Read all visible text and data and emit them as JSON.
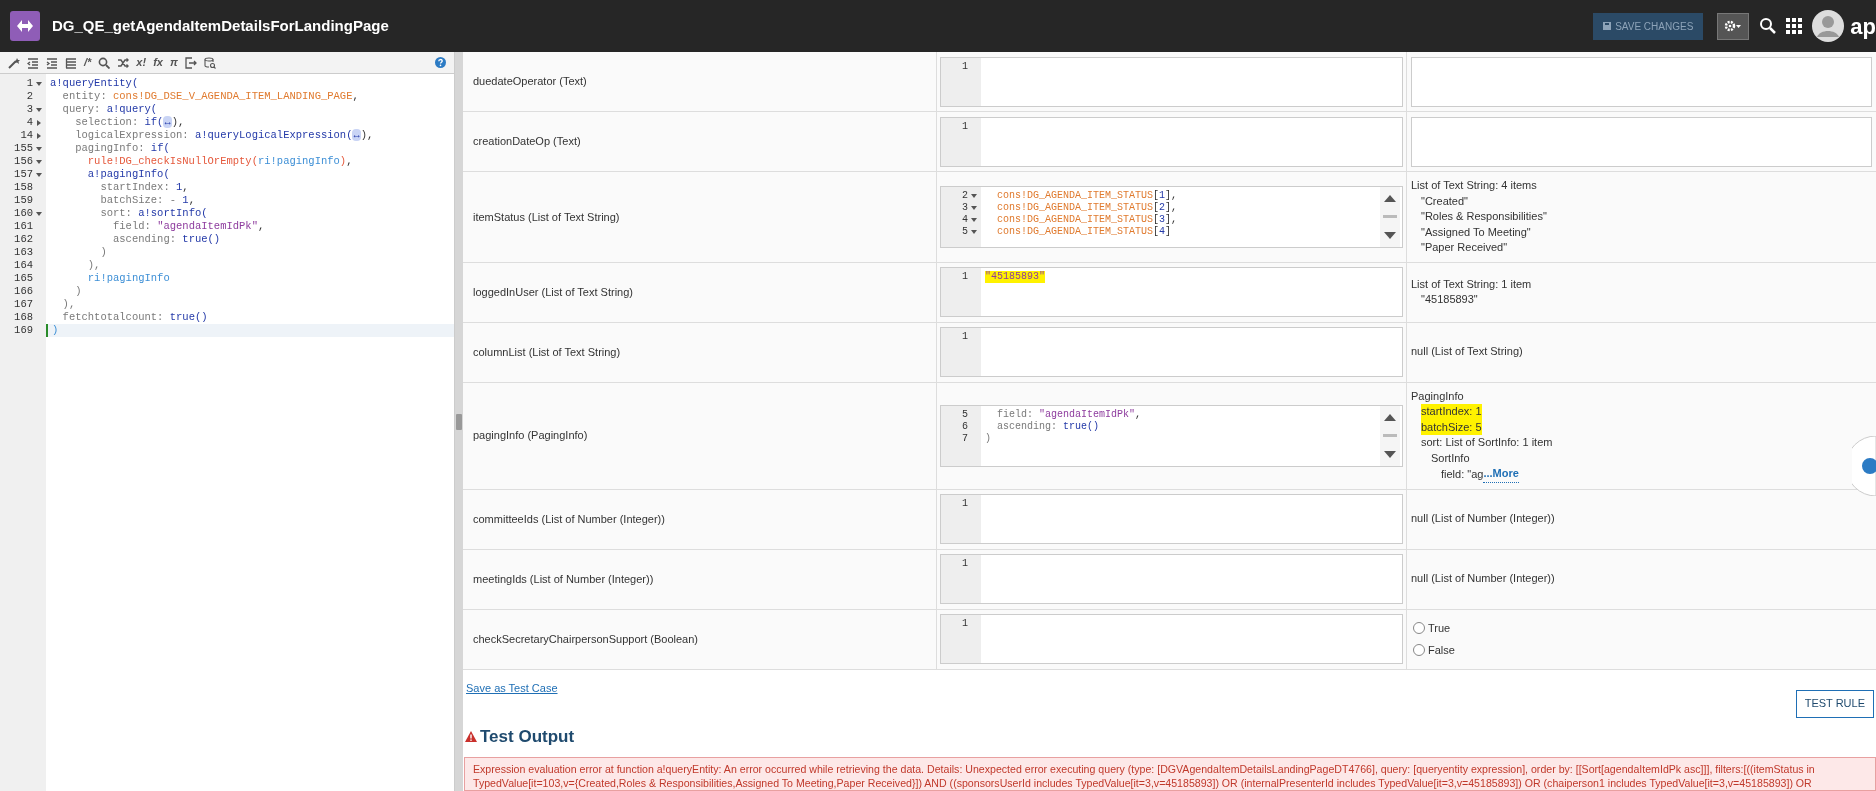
{
  "header": {
    "title": "DG_QE_getAgendaItemDetailsForLandingPage",
    "save_button": {
      "label": "SAVE CHANGES",
      "disabled": true
    },
    "brand_text": "ap"
  },
  "editor": {
    "toolbar": [
      {
        "kind": "wand"
      },
      {
        "kind": "outdent"
      },
      {
        "kind": "indent"
      },
      {
        "kind": "format"
      },
      {
        "kind": "glyph",
        "text": "/*"
      },
      {
        "kind": "search"
      },
      {
        "kind": "shuffle"
      },
      {
        "kind": "glyph",
        "text": "x!"
      },
      {
        "kind": "glyph",
        "text": "fx"
      },
      {
        "kind": "glyph",
        "text": "π"
      },
      {
        "kind": "export"
      },
      {
        "kind": "dbsearch"
      }
    ],
    "lines": [
      {
        "number": "1",
        "foldable": true,
        "expanded": true,
        "current": false,
        "tokens": [
          {
            "kind": "fn",
            "text": "a!queryEntity("
          }
        ]
      },
      {
        "number": "2",
        "foldable": false,
        "current": false,
        "tokens": [
          {
            "kind": "key",
            "text": "  entity: "
          },
          {
            "kind": "cons",
            "text": "cons!DG_DSE_V_AGENDA_ITEM_LANDING_PAGE"
          },
          {
            "kind": "punct",
            "text": ","
          }
        ]
      },
      {
        "number": "3",
        "foldable": true,
        "expanded": true,
        "current": false,
        "tokens": [
          {
            "kind": "key",
            "text": "  query: "
          },
          {
            "kind": "fn",
            "text": "a!query("
          }
        ]
      },
      {
        "number": "4",
        "foldable": true,
        "expanded": false,
        "current": false,
        "tokens": [
          {
            "kind": "key",
            "text": "    selection: "
          },
          {
            "kind": "fn",
            "text": "if("
          },
          {
            "kind": "folded",
            "text": "↔"
          },
          {
            "kind": "punct",
            "text": "),"
          }
        ]
      },
      {
        "number": "14",
        "foldable": true,
        "expanded": false,
        "current": false,
        "tokens": [
          {
            "kind": "key",
            "text": "    logicalExpression: "
          },
          {
            "kind": "fn",
            "text": "a!queryLogicalExpression("
          },
          {
            "kind": "folded",
            "text": "↔"
          },
          {
            "kind": "punct",
            "text": "),"
          }
        ]
      },
      {
        "number": "155",
        "foldable": true,
        "expanded": true,
        "current": false,
        "tokens": [
          {
            "kind": "key",
            "text": "    pagingInfo: "
          },
          {
            "kind": "fn",
            "text": "if("
          }
        ]
      },
      {
        "number": "156",
        "foldable": true,
        "expanded": true,
        "current": false,
        "tokens": [
          {
            "kind": "rule",
            "text": "      rule!DG_checkIsNullOrEmpty("
          },
          {
            "kind": "ri",
            "text": "ri!pagingInfo"
          },
          {
            "kind": "rule",
            "text": ")"
          },
          {
            "kind": "punct",
            "text": ","
          }
        ]
      },
      {
        "number": "157",
        "foldable": true,
        "expanded": true,
        "current": false,
        "tokens": [
          {
            "kind": "fn",
            "text": "      a!pagingInfo("
          }
        ]
      },
      {
        "number": "158",
        "foldable": false,
        "current": false,
        "tokens": [
          {
            "kind": "key",
            "text": "        startIndex: "
          },
          {
            "kind": "num",
            "text": "1"
          },
          {
            "kind": "punct",
            "text": ","
          }
        ]
      },
      {
        "number": "159",
        "foldable": false,
        "current": false,
        "tokens": [
          {
            "kind": "key",
            "text": "        batchSize: - "
          },
          {
            "kind": "num",
            "text": "1"
          },
          {
            "kind": "punct",
            "text": ","
          }
        ]
      },
      {
        "number": "160",
        "foldable": true,
        "expanded": true,
        "current": false,
        "tokens": [
          {
            "kind": "key",
            "text": "        sort: "
          },
          {
            "kind": "fn",
            "text": "a!sortInfo("
          }
        ]
      },
      {
        "number": "161",
        "foldable": false,
        "current": false,
        "tokens": [
          {
            "kind": "key",
            "text": "          field: "
          },
          {
            "kind": "str",
            "text": "\"agendaItemIdPk\""
          },
          {
            "kind": "punct",
            "text": ","
          }
        ]
      },
      {
        "number": "162",
        "foldable": false,
        "current": false,
        "tokens": [
          {
            "kind": "key",
            "text": "          ascending: "
          },
          {
            "kind": "fn",
            "text": "true()"
          }
        ]
      },
      {
        "number": "163",
        "foldable": false,
        "current": false,
        "tokens": [
          {
            "kind": "key",
            "text": "        )"
          }
        ]
      },
      {
        "number": "164",
        "foldable": false,
        "current": false,
        "tokens": [
          {
            "kind": "key",
            "text": "      ),"
          }
        ]
      },
      {
        "number": "165",
        "foldable": false,
        "current": false,
        "tokens": [
          {
            "kind": "ri",
            "text": "      ri!pagingInfo"
          }
        ]
      },
      {
        "number": "166",
        "foldable": false,
        "current": false,
        "tokens": [
          {
            "kind": "key",
            "text": "    )"
          }
        ]
      },
      {
        "number": "167",
        "foldable": false,
        "current": false,
        "tokens": [
          {
            "kind": "key",
            "text": "  ),"
          }
        ]
      },
      {
        "number": "168",
        "foldable": false,
        "current": false,
        "tokens": [
          {
            "kind": "key",
            "text": "  fetchtotalcount: "
          },
          {
            "kind": "fn",
            "text": "true()"
          }
        ]
      },
      {
        "number": "169",
        "foldable": false,
        "current": true,
        "tokens": [
          {
            "kind": "ri",
            "text": ")"
          }
        ]
      }
    ]
  },
  "inputs": [
    {
      "label": "duedateOperator (Text)",
      "editor": {
        "kind": "plain",
        "lines": [
          {
            "number": "1",
            "foldable": false
          }
        ]
      },
      "result": {
        "kind": "box"
      }
    },
    {
      "label": "creationDateOp (Text)",
      "editor": {
        "kind": "plain",
        "lines": [
          {
            "number": "1",
            "foldable": false
          }
        ]
      },
      "result": {
        "kind": "box"
      }
    },
    {
      "label": "itemStatus (List of Text String)",
      "editor": {
        "kind": "scroll",
        "lines": [
          {
            "number": "2",
            "foldable": true,
            "expanded": true,
            "highlighted": false,
            "tokens": [
              {
                "kind": "cons",
                "text": "  cons!DG_AGENDA_ITEM_STATUS"
              },
              {
                "kind": "punct",
                "text": "["
              },
              {
                "kind": "num",
                "text": "1"
              },
              {
                "kind": "punct",
                "text": "],"
              }
            ]
          },
          {
            "number": "3",
            "foldable": true,
            "expanded": true,
            "highlighted": false,
            "tokens": [
              {
                "kind": "cons",
                "text": "  cons!DG_AGENDA_ITEM_STATUS"
              },
              {
                "kind": "punct",
                "text": "["
              },
              {
                "kind": "num",
                "text": "2"
              },
              {
                "kind": "punct",
                "text": "],"
              }
            ]
          },
          {
            "number": "4",
            "foldable": true,
            "expanded": true,
            "highlighted": false,
            "tokens": [
              {
                "kind": "cons",
                "text": "  cons!DG_AGENDA_ITEM_STATUS"
              },
              {
                "kind": "punct",
                "text": "["
              },
              {
                "kind": "num",
                "text": "3"
              },
              {
                "kind": "punct",
                "text": "],"
              }
            ]
          },
          {
            "number": "5",
            "foldable": true,
            "expanded": true,
            "highlighted": false,
            "tokens": [
              {
                "kind": "cons",
                "text": "  cons!DG_AGENDA_ITEM_STATUS"
              },
              {
                "kind": "punct",
                "text": "["
              },
              {
                "kind": "num",
                "text": "4"
              },
              {
                "kind": "punct",
                "text": "]"
              }
            ]
          }
        ]
      },
      "result": {
        "kind": "tree",
        "items": [
          {
            "text": "List of Text String: 4 items",
            "highlighted": false,
            "children": [
              {
                "text": "\"Created\"",
                "highlighted": false
              },
              {
                "text": "\"Roles & Responsibilities\"",
                "highlighted": false
              },
              {
                "text": "\"Assigned To Meeting\"",
                "highlighted": false
              },
              {
                "text": "\"Paper Received\"",
                "highlighted": false
              }
            ]
          }
        ]
      }
    },
    {
      "label": "loggedInUser (List of Text String)",
      "editor": {
        "kind": "plain",
        "lines": [
          {
            "number": "1",
            "foldable": false,
            "highlighted": true,
            "tokens": [
              {
                "kind": "str",
                "text": "\"45185893\""
              }
            ]
          }
        ]
      },
      "result": {
        "kind": "tree",
        "items": [
          {
            "text": "List of Text String: 1 item",
            "highlighted": false,
            "children": [
              {
                "text": "\"45185893\"",
                "highlighted": false
              }
            ]
          }
        ]
      }
    },
    {
      "label": "columnList (List of Text String)",
      "editor": {
        "kind": "plain",
        "lines": [
          {
            "number": "1",
            "foldable": false
          }
        ]
      },
      "result": {
        "kind": "tree",
        "items": [
          {
            "text": "null (List of Text String)",
            "highlighted": false
          }
        ]
      }
    },
    {
      "label": "pagingInfo (PagingInfo)",
      "editor": {
        "kind": "scroll",
        "lines": [
          {
            "number": "5",
            "foldable": false,
            "highlighted": false,
            "tokens": [
              {
                "kind": "key",
                "text": "  field: "
              },
              {
                "kind": "str",
                "text": "\"agendaItemIdPk\""
              },
              {
                "kind": "punct",
                "text": ","
              }
            ]
          },
          {
            "number": "6",
            "foldable": false,
            "highlighted": false,
            "tokens": [
              {
                "kind": "key",
                "text": "  ascending: "
              },
              {
                "kind": "fn",
                "text": "true()"
              }
            ]
          },
          {
            "number": "7",
            "foldable": false,
            "highlighted": false,
            "tokens": [
              {
                "kind": "key",
                "text": ")"
              }
            ]
          }
        ]
      },
      "result": {
        "kind": "tree",
        "items": [
          {
            "text": "PagingInfo",
            "highlighted": false,
            "children": [
              {
                "text": "startIndex: 1",
                "highlighted": true
              },
              {
                "text": "batchSize: 5",
                "highlighted": true
              },
              {
                "text": "sort: List of SortInfo: 1 item",
                "highlighted": false,
                "children": [
                  {
                    "text": "SortInfo",
                    "highlighted": false,
                    "children": [
                      {
                        "text": "field: \"ag",
                        "highlighted": false,
                        "more": "...More"
                      }
                    ]
                  }
                ]
              }
            ]
          }
        ]
      }
    },
    {
      "label": "committeeIds (List of Number (Integer))",
      "editor": {
        "kind": "plain",
        "lines": [
          {
            "number": "1",
            "foldable": false
          }
        ]
      },
      "result": {
        "kind": "tree",
        "items": [
          {
            "text": "null (List of Number (Integer))",
            "highlighted": false
          }
        ]
      }
    },
    {
      "label": "meetingIds (List of Number (Integer))",
      "editor": {
        "kind": "plain",
        "lines": [
          {
            "number": "1",
            "foldable": false
          }
        ]
      },
      "result": {
        "kind": "tree",
        "items": [
          {
            "text": "null (List of Number (Integer))",
            "highlighted": false
          }
        ]
      }
    },
    {
      "label": "checkSecretaryChairpersonSupport (Boolean)",
      "editor": {
        "kind": "plain",
        "lines": [
          {
            "number": "1",
            "foldable": false
          }
        ]
      },
      "result": {
        "kind": "radio",
        "options": [
          {
            "label": "True",
            "selected": false
          },
          {
            "label": "False",
            "selected": false
          }
        ]
      }
    }
  ],
  "save_test_case": "Save as Test Case",
  "test_rule_button": "TEST RULE",
  "test_output": {
    "title": "Test Output",
    "error": "Expression evaluation error at function a!queryEntity: An error occurred while retrieving the data. Details: Unexpected error executing query (type: [DGVAgendaItemDetailsLandingPageDT4766], query: [queryentity expression], order by: [[Sort[agendaItemIdPk asc]]], filters:[((itemStatus in TypedValue[it=103,v={Created,Roles & Responsibilities,Assigned To Meeting,Paper Received}]) AND ((sponsorsUserId includes TypedValue[it=3,v=45185893]) OR (internalPresenterId includes TypedValue[it=3,v=45185893]) OR (chaiperson1 includes TypedValue[it=3,v=45185893]) OR"
  }
}
